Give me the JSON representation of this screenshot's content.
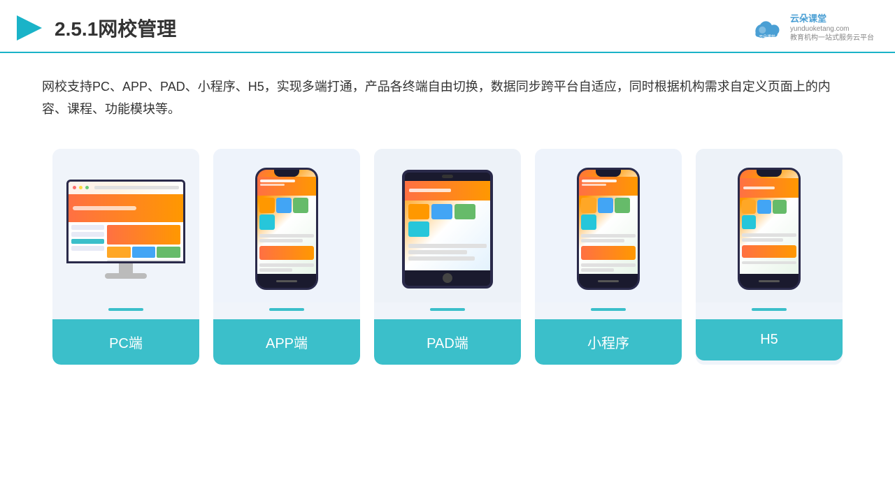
{
  "header": {
    "title": "2.5.1网校管理",
    "logo_name": "云朵课堂",
    "logo_url": "yunduoketang.com",
    "logo_tagline": "教育机构一站式服务云平台"
  },
  "description": {
    "text": "网校支持PC、APP、PAD、小程序、H5，实现多端打通，产品各终端自由切换，数据同步跨平台自适应，同时根据机构需求自定义页面上的内容、课程、功能模块等。"
  },
  "cards": [
    {
      "id": "pc",
      "label": "PC端"
    },
    {
      "id": "app",
      "label": "APP端"
    },
    {
      "id": "pad",
      "label": "PAD端"
    },
    {
      "id": "miniprogram",
      "label": "小程序"
    },
    {
      "id": "h5",
      "label": "H5"
    }
  ],
  "colors": {
    "accent": "#3bbfca",
    "header_border": "#1ab3c8",
    "title": "#333333",
    "text": "#333333"
  }
}
